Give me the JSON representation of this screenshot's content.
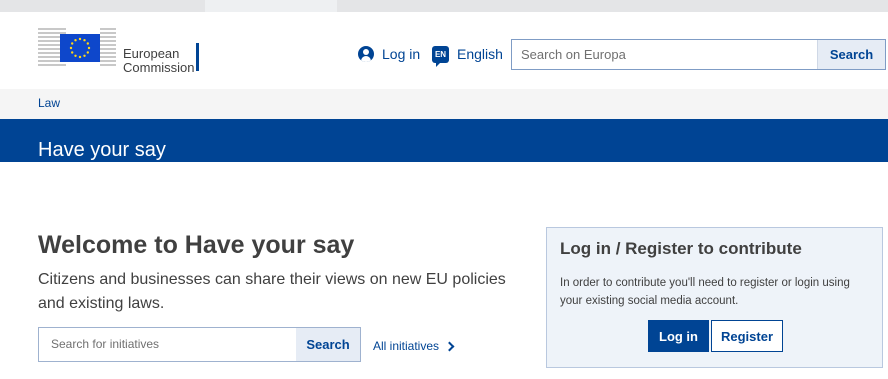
{
  "header": {
    "logo": {
      "name": "european-commission-logo",
      "line1": "European",
      "line2": "Commission"
    },
    "login_label": "Log in",
    "language_code": "EN",
    "language_label": "English",
    "search_placeholder": "Search on Europa",
    "search_button": "Search"
  },
  "breadcrumb": {
    "items": [
      "Law"
    ]
  },
  "page": {
    "title": "Have your say"
  },
  "main": {
    "heading": "Welcome to Have your say",
    "lead": "Citizens and businesses can share their views on new EU policies and existing laws.",
    "search_placeholder": "Search for initiatives",
    "search_button": "Search",
    "all_initiatives_link": "All initiatives"
  },
  "contribute_panel": {
    "title": "Log in / Register to contribute",
    "text": "In order to contribute you'll need to register or login using your existing social media account.",
    "login_button": "Log in",
    "register_button": "Register"
  },
  "colors": {
    "brand": "#004494",
    "breadcrumb_bg": "#f5f5f5",
    "panel_bg": "#eef3f9"
  }
}
